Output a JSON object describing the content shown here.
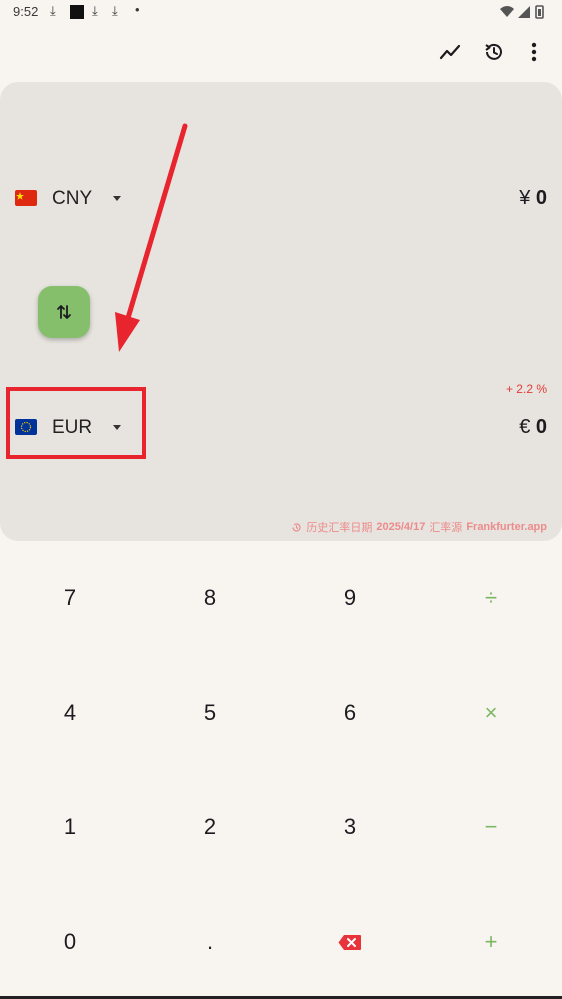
{
  "status_bar": {
    "time": "9:52",
    "download_icon": "download-icon",
    "dot": "•"
  },
  "toolbar": {
    "chart_icon": "trend-chart-icon",
    "history_icon": "history-icon",
    "menu_icon": "more-vert-icon"
  },
  "from_currency": {
    "code": "CNY",
    "symbol": "¥",
    "amount": "0",
    "flag": "china-flag-icon"
  },
  "to_currency": {
    "code": "EUR",
    "symbol": "€",
    "amount": "0",
    "flag": "eu-flag-icon"
  },
  "swap_icon": "swap-vertical-icon",
  "rate_change": "+ 2.2 %",
  "history_note": {
    "prefix": "历史汇率日期",
    "date": "2025/4/17",
    "source_label": "汇率源",
    "source": "Frankfurter.app"
  },
  "keypad": {
    "k7": "7",
    "k8": "8",
    "k9": "9",
    "divide": "÷",
    "k4": "4",
    "k5": "5",
    "k6": "6",
    "multiply": "×",
    "k1": "1",
    "k2": "2",
    "k3": "3",
    "minus": "−",
    "k0": "0",
    "dot": ".",
    "plus": "+"
  },
  "colors": {
    "accent_green": "#86bf6c",
    "operator_green": "#7bb661",
    "annotation_red": "#e8242f",
    "change_red": "#e53935",
    "card_bg": "#e7e4df",
    "page_bg": "#f8f5f0"
  }
}
